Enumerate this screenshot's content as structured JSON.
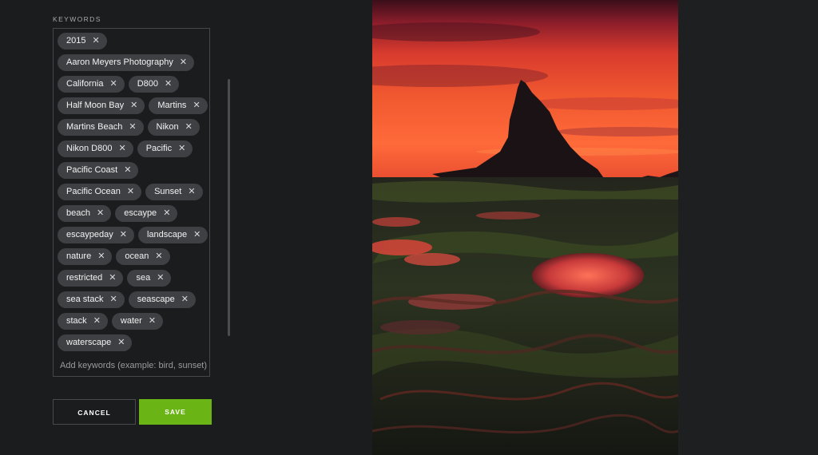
{
  "keywords_panel": {
    "label": "KEYWORDS",
    "chips": [
      "2015",
      "Aaron Meyers Photography",
      "California",
      "D800",
      "Half Moon Bay",
      "Martins",
      "Martins Beach",
      "Nikon",
      "Nikon D800",
      "Pacific",
      "Pacific Coast",
      "Pacific Ocean",
      "Sunset",
      "beach",
      "escaype",
      "escaypeday",
      "landscape",
      "nature",
      "ocean",
      "restricted",
      "sea",
      "sea stack",
      "seascape",
      "stack",
      "water",
      "waterscape"
    ],
    "remove_symbol": "✕",
    "input_placeholder": "Add keywords (example: bird, sunset)"
  },
  "buttons": {
    "cancel": "CANCEL",
    "save": "SAVE"
  },
  "colors": {
    "background": "#1b1c1e",
    "chip": "#3e4044",
    "save_accent": "#6ab515"
  },
  "photo": {
    "subject": "sunset-sea-stack-photo"
  }
}
